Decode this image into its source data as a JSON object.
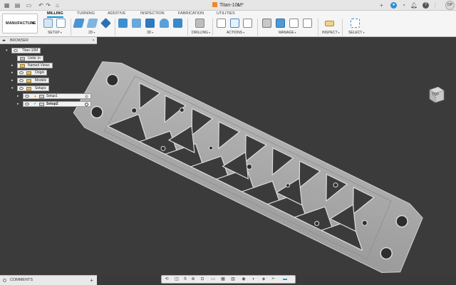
{
  "document": {
    "title": "Titan-10M*"
  },
  "workspace": {
    "label": "MANUFACTURE"
  },
  "tabs": [
    {
      "label": "MILLING",
      "active": true
    },
    {
      "label": "TURNING"
    },
    {
      "label": "ADDITIVE"
    },
    {
      "label": "INSPECTION"
    },
    {
      "label": "FABRICATION"
    },
    {
      "label": "UTILITIES"
    }
  ],
  "groups": {
    "setup": "SETUP",
    "two_d": "2D",
    "three_d": "3D",
    "drilling": "DRILLING",
    "actions": "ACTIONS",
    "manage": "MANAGE",
    "inspect": "INSPECT",
    "select": "SELECT"
  },
  "user": {
    "initials": "DP"
  },
  "browser": {
    "title": "BROWSER",
    "root": "Titan-10M",
    "units": "Units: in",
    "named_views": "Named Views",
    "origin": "Origin",
    "models": "Models",
    "setups": "Setups",
    "setup1": "Setup1",
    "setup2": "Setup2"
  },
  "viewcube": {
    "face": "TOP"
  },
  "comments": {
    "label": "COMMENTS"
  },
  "colors": {
    "accent": "#0696d7",
    "part": "#a9a9a9",
    "viewport": "#3b3b3b"
  },
  "icons": {
    "navbar": [
      "orbit-icon",
      "look-at-icon",
      "pan-icon",
      "zoom-icon",
      "zoom-window-icon",
      "display-icon",
      "grid-icon",
      "viewports-icon",
      "camera-icon",
      "effects-icon",
      "section-icon",
      "simulate-icon",
      "stock-icon"
    ]
  }
}
